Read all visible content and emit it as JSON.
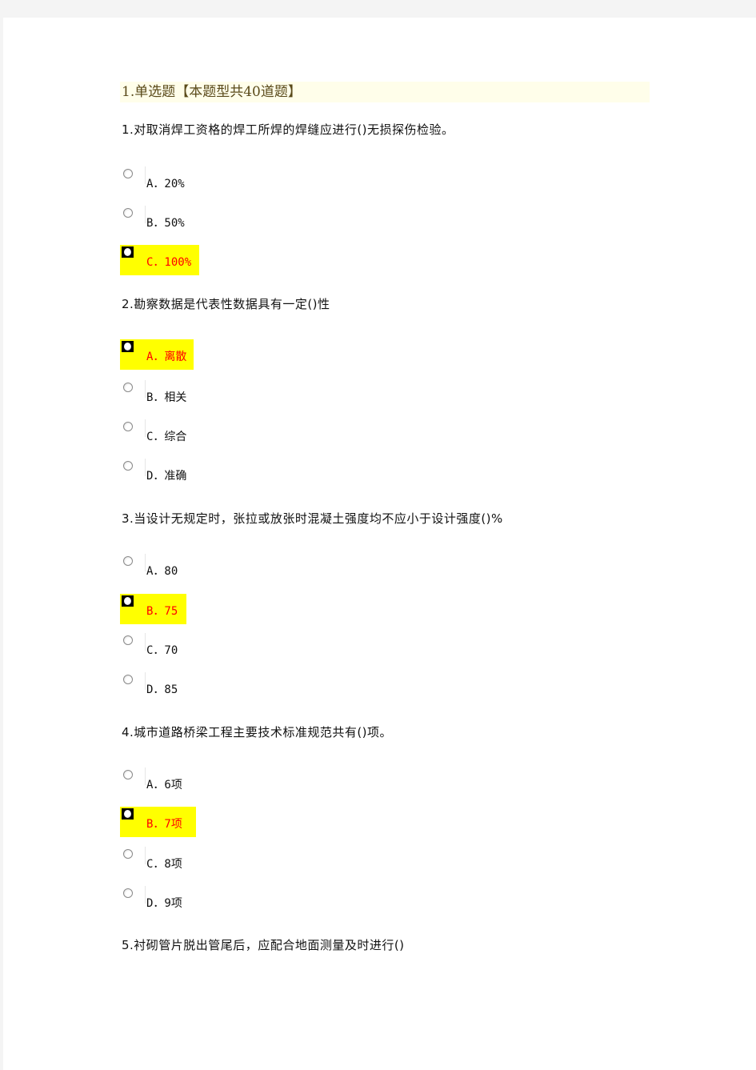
{
  "section": {
    "heading": "1.单选题【本题型共40道题】"
  },
  "colors": {
    "selected_highlight": "#ffff00",
    "selected_text": "#ff0000",
    "heading_background": "#fffeea"
  },
  "questions": [
    {
      "text": "1.对取消焊工资格的焊工所焊的焊缝应进行()无损探伤检验。",
      "options": [
        {
          "label": "A．20%",
          "selected": false
        },
        {
          "label": "B．50%",
          "selected": false
        },
        {
          "label": "C．100%",
          "selected": true
        }
      ]
    },
    {
      "text": "2.勘察数据是代表性数据具有一定()性",
      "options": [
        {
          "label": "A．离散",
          "selected": true
        },
        {
          "label": "B．相关",
          "selected": false
        },
        {
          "label": "C．综合",
          "selected": false
        },
        {
          "label": "D．准确",
          "selected": false
        }
      ]
    },
    {
      "text": "3.当设计无规定时，张拉或放张时混凝土强度均不应小于设计强度()%",
      "options": [
        {
          "label": "A．80",
          "selected": false
        },
        {
          "label": "B．75",
          "selected": true
        },
        {
          "label": "C．70",
          "selected": false
        },
        {
          "label": "D．85",
          "selected": false
        }
      ]
    },
    {
      "text": "4.城市道路桥梁工程主要技术标准规范共有()项。",
      "options": [
        {
          "label": "A．6项",
          "selected": false
        },
        {
          "label": "B．7项",
          "selected": true
        },
        {
          "label": "C．8项",
          "selected": false
        },
        {
          "label": "D．9项",
          "selected": false
        }
      ]
    },
    {
      "text": "5.衬砌管片脱出管尾后，应配合地面测量及时进行()",
      "options": []
    }
  ]
}
